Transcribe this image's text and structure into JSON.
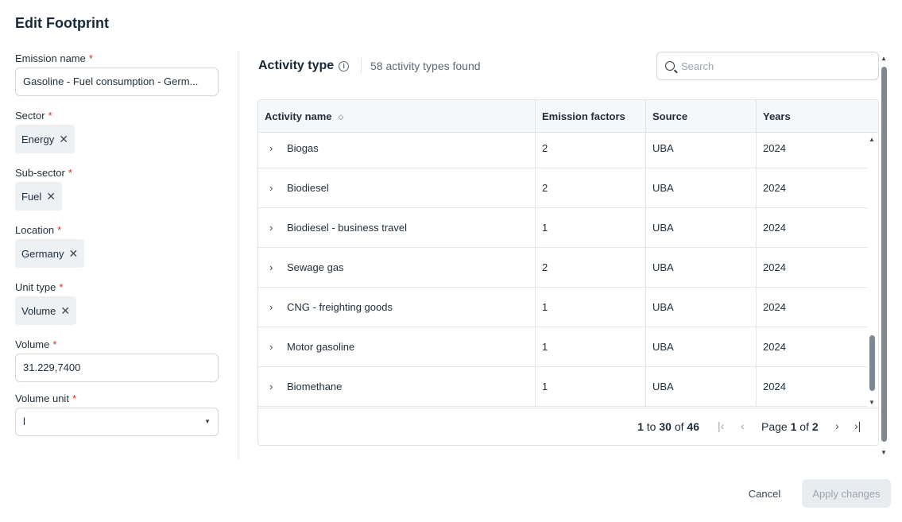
{
  "dialog": {
    "title": "Edit Footprint"
  },
  "form": {
    "required_mark": "*",
    "emission_name": {
      "label": "Emission name",
      "value": "Gasoline - Fuel consumption - Germ..."
    },
    "sector": {
      "label": "Sector",
      "chip": "Energy"
    },
    "sub_sector": {
      "label": "Sub-sector",
      "chip": "Fuel"
    },
    "location": {
      "label": "Location",
      "chip": "Germany"
    },
    "unit_type": {
      "label": "Unit type",
      "chip": "Volume"
    },
    "volume": {
      "label": "Volume",
      "value": "31.229,7400"
    },
    "volume_unit": {
      "label": "Volume unit",
      "value": "l"
    }
  },
  "activity": {
    "title": "Activity type",
    "count_text": "58 activity types found",
    "search_placeholder": "Search",
    "columns": [
      "Activity name",
      "Emission factors",
      "Source",
      "Years"
    ],
    "rows": [
      {
        "name": "Biogas",
        "factors": "2",
        "source": "UBA",
        "years": "2024"
      },
      {
        "name": "Biodiesel",
        "factors": "2",
        "source": "UBA",
        "years": "2024"
      },
      {
        "name": "Biodiesel - business travel",
        "factors": "1",
        "source": "UBA",
        "years": "2024"
      },
      {
        "name": "Sewage gas",
        "factors": "2",
        "source": "UBA",
        "years": "2024"
      },
      {
        "name": "CNG - freighting goods",
        "factors": "1",
        "source": "UBA",
        "years": "2024"
      },
      {
        "name": "Motor gasoline",
        "factors": "1",
        "source": "UBA",
        "years": "2024"
      },
      {
        "name": "Biomethane",
        "factors": "1",
        "source": "UBA",
        "years": "2024"
      }
    ],
    "pagination": {
      "from": "1",
      "to_word": "to",
      "to": "30",
      "of_word": "of",
      "total": "46",
      "page_word": "Page",
      "page": "1",
      "pages": "2"
    }
  },
  "footer": {
    "cancel_label": "Cancel",
    "apply_label": "Apply changes"
  },
  "colors": {
    "required": "#d92d20",
    "chip_bg": "#eef1f4",
    "disabled_button": "#e9ecef"
  }
}
